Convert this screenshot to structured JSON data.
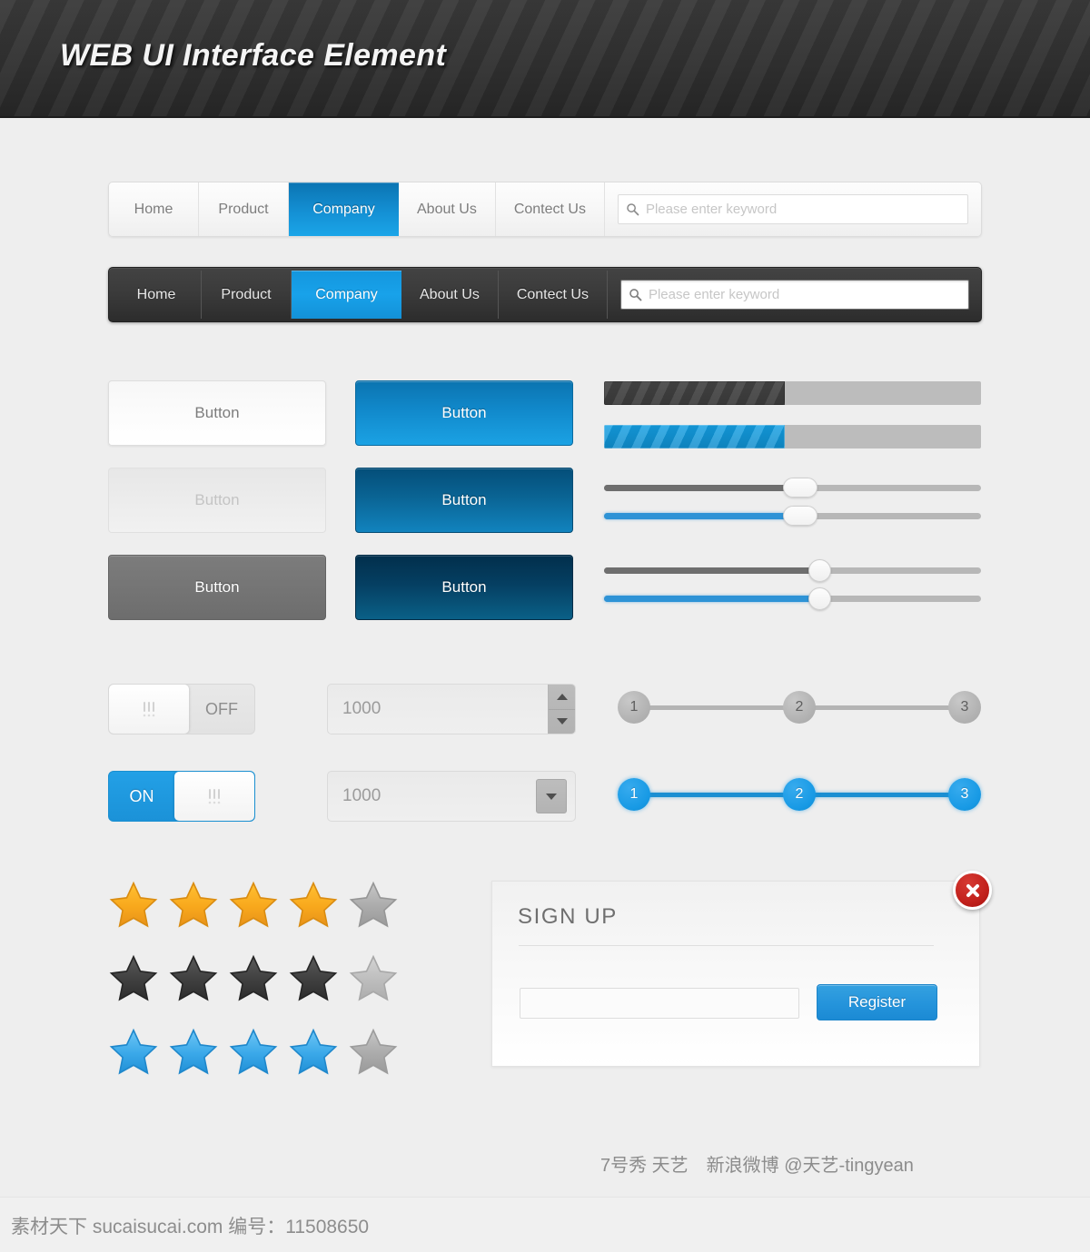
{
  "header": {
    "title": "WEB UI Interface Element"
  },
  "colors": {
    "page_bg": "#eeeeee",
    "header_bg": "#303030",
    "accent_blue": "#1b9ee0",
    "accent_blue_dark": "#0b74b0",
    "star_orange": "#f5a623",
    "star_gray": "#aaaaaa",
    "star_dark": "#454545",
    "star_blue": "#3aa9ea",
    "close_red": "#c2211c"
  },
  "nav_light": {
    "items": [
      {
        "label": "Home",
        "active": false
      },
      {
        "label": "Product",
        "active": false
      },
      {
        "label": "Company",
        "active": true
      },
      {
        "label": "About Us",
        "active": false
      },
      {
        "label": "Contect Us",
        "active": false
      }
    ],
    "search": {
      "placeholder": "Please enter keyword",
      "value": "",
      "icon": "search-icon"
    }
  },
  "nav_dark": {
    "items": [
      {
        "label": "Home",
        "active": false
      },
      {
        "label": "Product",
        "active": false
      },
      {
        "label": "Company",
        "active": true
      },
      {
        "label": "About Us",
        "active": false
      },
      {
        "label": "Contect Us",
        "active": false
      }
    ],
    "search": {
      "placeholder": "Please enter keyword",
      "value": "",
      "icon": "search-icon"
    }
  },
  "buttons": {
    "white": {
      "label": "Button",
      "state": "normal"
    },
    "disabled": {
      "label": "Button",
      "state": "disabled"
    },
    "gray": {
      "label": "Button",
      "state": "normal"
    },
    "blue_light": {
      "label": "Button",
      "state": "normal"
    },
    "blue_medium": {
      "label": "Button",
      "state": "normal"
    },
    "blue_dark": {
      "label": "Button",
      "state": "normal"
    }
  },
  "progress_bars": [
    {
      "name": "dark",
      "percent": 48
    },
    {
      "name": "blue",
      "percent": 48
    }
  ],
  "sliders": [
    {
      "name": "dark-rect",
      "percent": 52,
      "handle": "rect"
    },
    {
      "name": "blue-rect",
      "percent": 52,
      "handle": "rect"
    },
    {
      "name": "dark-circle",
      "percent": 57,
      "handle": "circle"
    },
    {
      "name": "blue-circle",
      "percent": 57,
      "handle": "circle"
    }
  ],
  "toggles": {
    "off": {
      "label": "OFF",
      "state": "off"
    },
    "on": {
      "label": "ON",
      "state": "on"
    }
  },
  "spinner": {
    "value": "1000",
    "up_icon": "triangle-up-icon",
    "down_icon": "triangle-down-icon"
  },
  "select": {
    "value": "1000",
    "icon": "chevron-down-icon"
  },
  "steps": {
    "gray": {
      "labels": [
        "1",
        "2",
        "3"
      ]
    },
    "blue": {
      "labels": [
        "1",
        "2",
        "3"
      ]
    }
  },
  "ratings": [
    {
      "name": "orange",
      "filled": 4,
      "total": 5
    },
    {
      "name": "dark",
      "filled": 4,
      "total": 5
    },
    {
      "name": "blue",
      "filled": 4,
      "total": 5
    }
  ],
  "signup": {
    "title": "SIGN UP",
    "input": {
      "value": "",
      "placeholder": ""
    },
    "register_label": "Register",
    "close_icon": "close-icon"
  },
  "footer": {
    "credit": "7号秀 天艺　新浪微博 @天艺-tingyean",
    "watermark": "素材天下 sucaisucai.com  编号：11508650"
  }
}
